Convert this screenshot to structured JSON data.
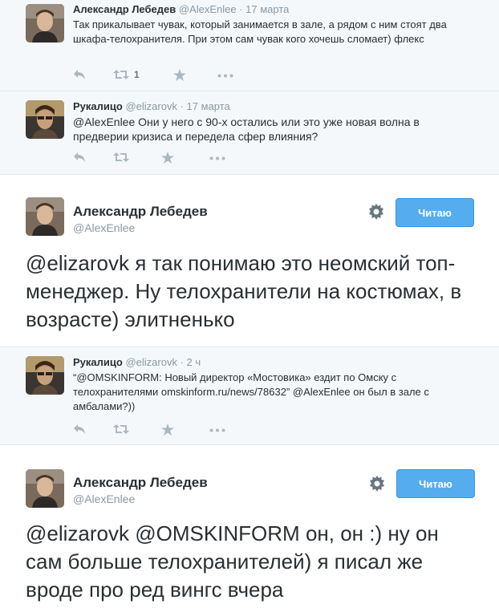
{
  "tweets": [
    {
      "fullname": "Александр Лебедев",
      "handle": "@AlexEnlee",
      "date": "· 17 марта",
      "text": "Так прикалывает чувак, который занимается в зале, а рядом с ним стоят два шкафа-телохранителя. При этом сам чувак кого хочешь сломает) флекс",
      "retweet_count": "1"
    },
    {
      "fullname": "Рукалицо",
      "handle": "@elizarovk",
      "date": "· 17 марта",
      "mention": "@AlexEnlee",
      "text": " Они у него с 90-х остались или это уже новая волна в предверии кризиса и передела сфер влияния?"
    },
    {
      "fullname": "Александр Лебедев",
      "handle": "@AlexEnlee",
      "follow_label": "Читаю",
      "mention": "@elizarovk",
      "text": " я так понимаю это неомский топ-менеджер. Ну телохранители на костюмах, в возрасте) элитненько"
    },
    {
      "fullname": "Рукалицо",
      "handle": "@elizarovk",
      "date": "· 2 ч",
      "text_part1": "“",
      "mention1": "@OMSKINFORM",
      "text_part2": ": Новый директор «Мостовика» ездит по Омску с телохранителями omskinform.ru/news/78632” ",
      "mention2": "@AlexEnlee",
      "text_part3": " он был в зале с амбалами?))"
    },
    {
      "fullname": "Александр Лебедев",
      "handle": "@AlexEnlee",
      "follow_label": "Читаю",
      "mention1": "@elizarovk",
      "mention2": "@OMSKINFORM",
      "text": " он, он :) ну он сам больше телохранителей) я писал же вроде про ред вингс вчера"
    }
  ],
  "icons": {
    "reply": "reply-icon",
    "retweet": "retweet-icon",
    "favorite": "star-icon",
    "more": "more-icon",
    "settings": "gear-icon"
  },
  "colors": {
    "follow_button": "#55acee",
    "meta_text": "#8899a6",
    "action_icon": "#aab8c2"
  }
}
